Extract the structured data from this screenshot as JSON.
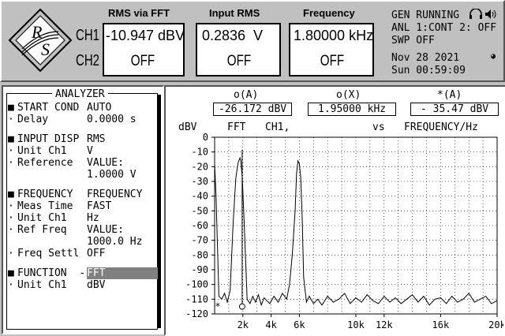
{
  "header": {
    "rms_fft": {
      "title": "RMS via FFT",
      "ch1": "-10.947 dBV",
      "ch2": "OFF"
    },
    "input_rms": {
      "title": "Input RMS",
      "ch1": "0.2836  V",
      "ch2": "OFF"
    },
    "frequency": {
      "title": "Frequency",
      "ch1": "1.80000 kHz",
      "ch2": "OFF"
    },
    "ch1_label": "CH1",
    "ch2_label": "CH2",
    "status": {
      "line1": "GEN RUNNING",
      "line2": "ANL 1:CONT 2: OFF",
      "line3": "SWP OFF",
      "date": "Nov 28 2021",
      "time": "Sun 00:59:09"
    },
    "logo_text": "R/S"
  },
  "analyzer": {
    "title": "ANALYZER",
    "rows": [
      {
        "bullet": "■",
        "label": "START COND",
        "value": "AUTO"
      },
      {
        "bullet": "·",
        "label": "Delay",
        "value": "0.0000 s"
      },
      {
        "bullet": "",
        "label": "",
        "value": ""
      },
      {
        "bullet": "■",
        "label": "INPUT DISP",
        "value": "RMS"
      },
      {
        "bullet": "·",
        "label": "Unit Ch1",
        "value": "V"
      },
      {
        "bullet": "·",
        "label": "Reference",
        "value": "VALUE:"
      },
      {
        "bullet": "",
        "label": "",
        "value": "1.0000 V"
      },
      {
        "bullet": "",
        "label": "",
        "value": ""
      },
      {
        "bullet": "■",
        "label": "FREQUENCY",
        "value": "FREQUENCY"
      },
      {
        "bullet": "·",
        "label": "Meas Time",
        "value": "FAST"
      },
      {
        "bullet": "·",
        "label": "Unit Ch1",
        "value": "Hz"
      },
      {
        "bullet": "·",
        "label": "Ref Freq",
        "value": "VALUE:"
      },
      {
        "bullet": "",
        "label": "",
        "value": "1000.0 Hz"
      },
      {
        "bullet": "·",
        "label": "Freq Settl",
        "value": "OFF"
      },
      {
        "bullet": "",
        "label": "",
        "value": ""
      },
      {
        "bullet": "■",
        "label": "FUNCTION  -",
        "value": "FFT",
        "highlight": true
      },
      {
        "bullet": "·",
        "label": "Unit Ch1",
        "value": "dBV"
      }
    ]
  },
  "graph": {
    "markers": {
      "o_a_label": "o(A)",
      "o_a_value": "-26.172 dBV",
      "o_x_label": "o(X)",
      "o_x_value": "1.95000 kHz",
      "star_a_label": "*(A)",
      "star_a_value": "- 35.47 dBV"
    },
    "y_unit": "dBV",
    "trace_fft": "FFT",
    "trace_ch": "CH1,",
    "trace_vs": "vs",
    "trace_x": "FREQUENCY/Hz"
  },
  "chart_data": {
    "type": "line",
    "xlabel": "FREQUENCY/Hz",
    "ylabel": "dBV",
    "xlim": [
      0,
      20000
    ],
    "ylim": [
      -120,
      0
    ],
    "y_ticks": [
      0,
      -10,
      -20,
      -30,
      -40,
      -50,
      -60,
      -70,
      -80,
      -90,
      -100,
      -110,
      -120
    ],
    "x_tick_labels": [
      "2k",
      "4k",
      "6k",
      "10k",
      "12k",
      "16k",
      "20k"
    ],
    "x_tick_values": [
      2000,
      4000,
      6000,
      10000,
      12000,
      16000,
      20000
    ],
    "series": [
      {
        "x": [
          0,
          100,
          300,
          500,
          700,
          900,
          1100,
          1300,
          1500,
          1650,
          1750,
          1800,
          1850,
          1950,
          2100,
          2300,
          2500,
          2700,
          2900,
          3100,
          3300,
          3500,
          3700,
          3900,
          4200,
          4500,
          4800,
          5100,
          5300,
          5500,
          5700,
          5800,
          5900,
          6000,
          6100,
          6200,
          6300,
          6500,
          6700,
          7000,
          7300,
          7600,
          8000,
          8400,
          8800,
          9200,
          9600,
          10000,
          10400,
          10800,
          11200,
          11600,
          12000,
          12400,
          12800,
          13200,
          13600,
          14000,
          14400,
          14800,
          15200,
          15600,
          16000,
          16400,
          16800,
          17200,
          17600,
          18000,
          18400,
          18800,
          19200,
          19600,
          20000
        ],
        "y": [
          -18,
          -40,
          -108,
          -110,
          -106,
          -112,
          -104,
          -60,
          -28,
          -18,
          -15,
          -14,
          -16,
          -26,
          -60,
          -110,
          -113,
          -108,
          -112,
          -107,
          -114,
          -109,
          -111,
          -113,
          -108,
          -112,
          -106,
          -110,
          -100,
          -80,
          -50,
          -25,
          -16,
          -18,
          -28,
          -55,
          -95,
          -112,
          -108,
          -113,
          -110,
          -114,
          -108,
          -112,
          -110,
          -106,
          -113,
          -109,
          -112,
          -107,
          -111,
          -113,
          -108,
          -112,
          -109,
          -113,
          -110,
          -107,
          -112,
          -108,
          -114,
          -110,
          -109,
          -113,
          -108,
          -112,
          -110,
          -106,
          -112,
          -110,
          -108,
          -113,
          -111
        ]
      }
    ],
    "marker_o_x": 1950,
    "marker_o_y": -115,
    "marker_star_x": 0,
    "marker_star_y": -115
  }
}
